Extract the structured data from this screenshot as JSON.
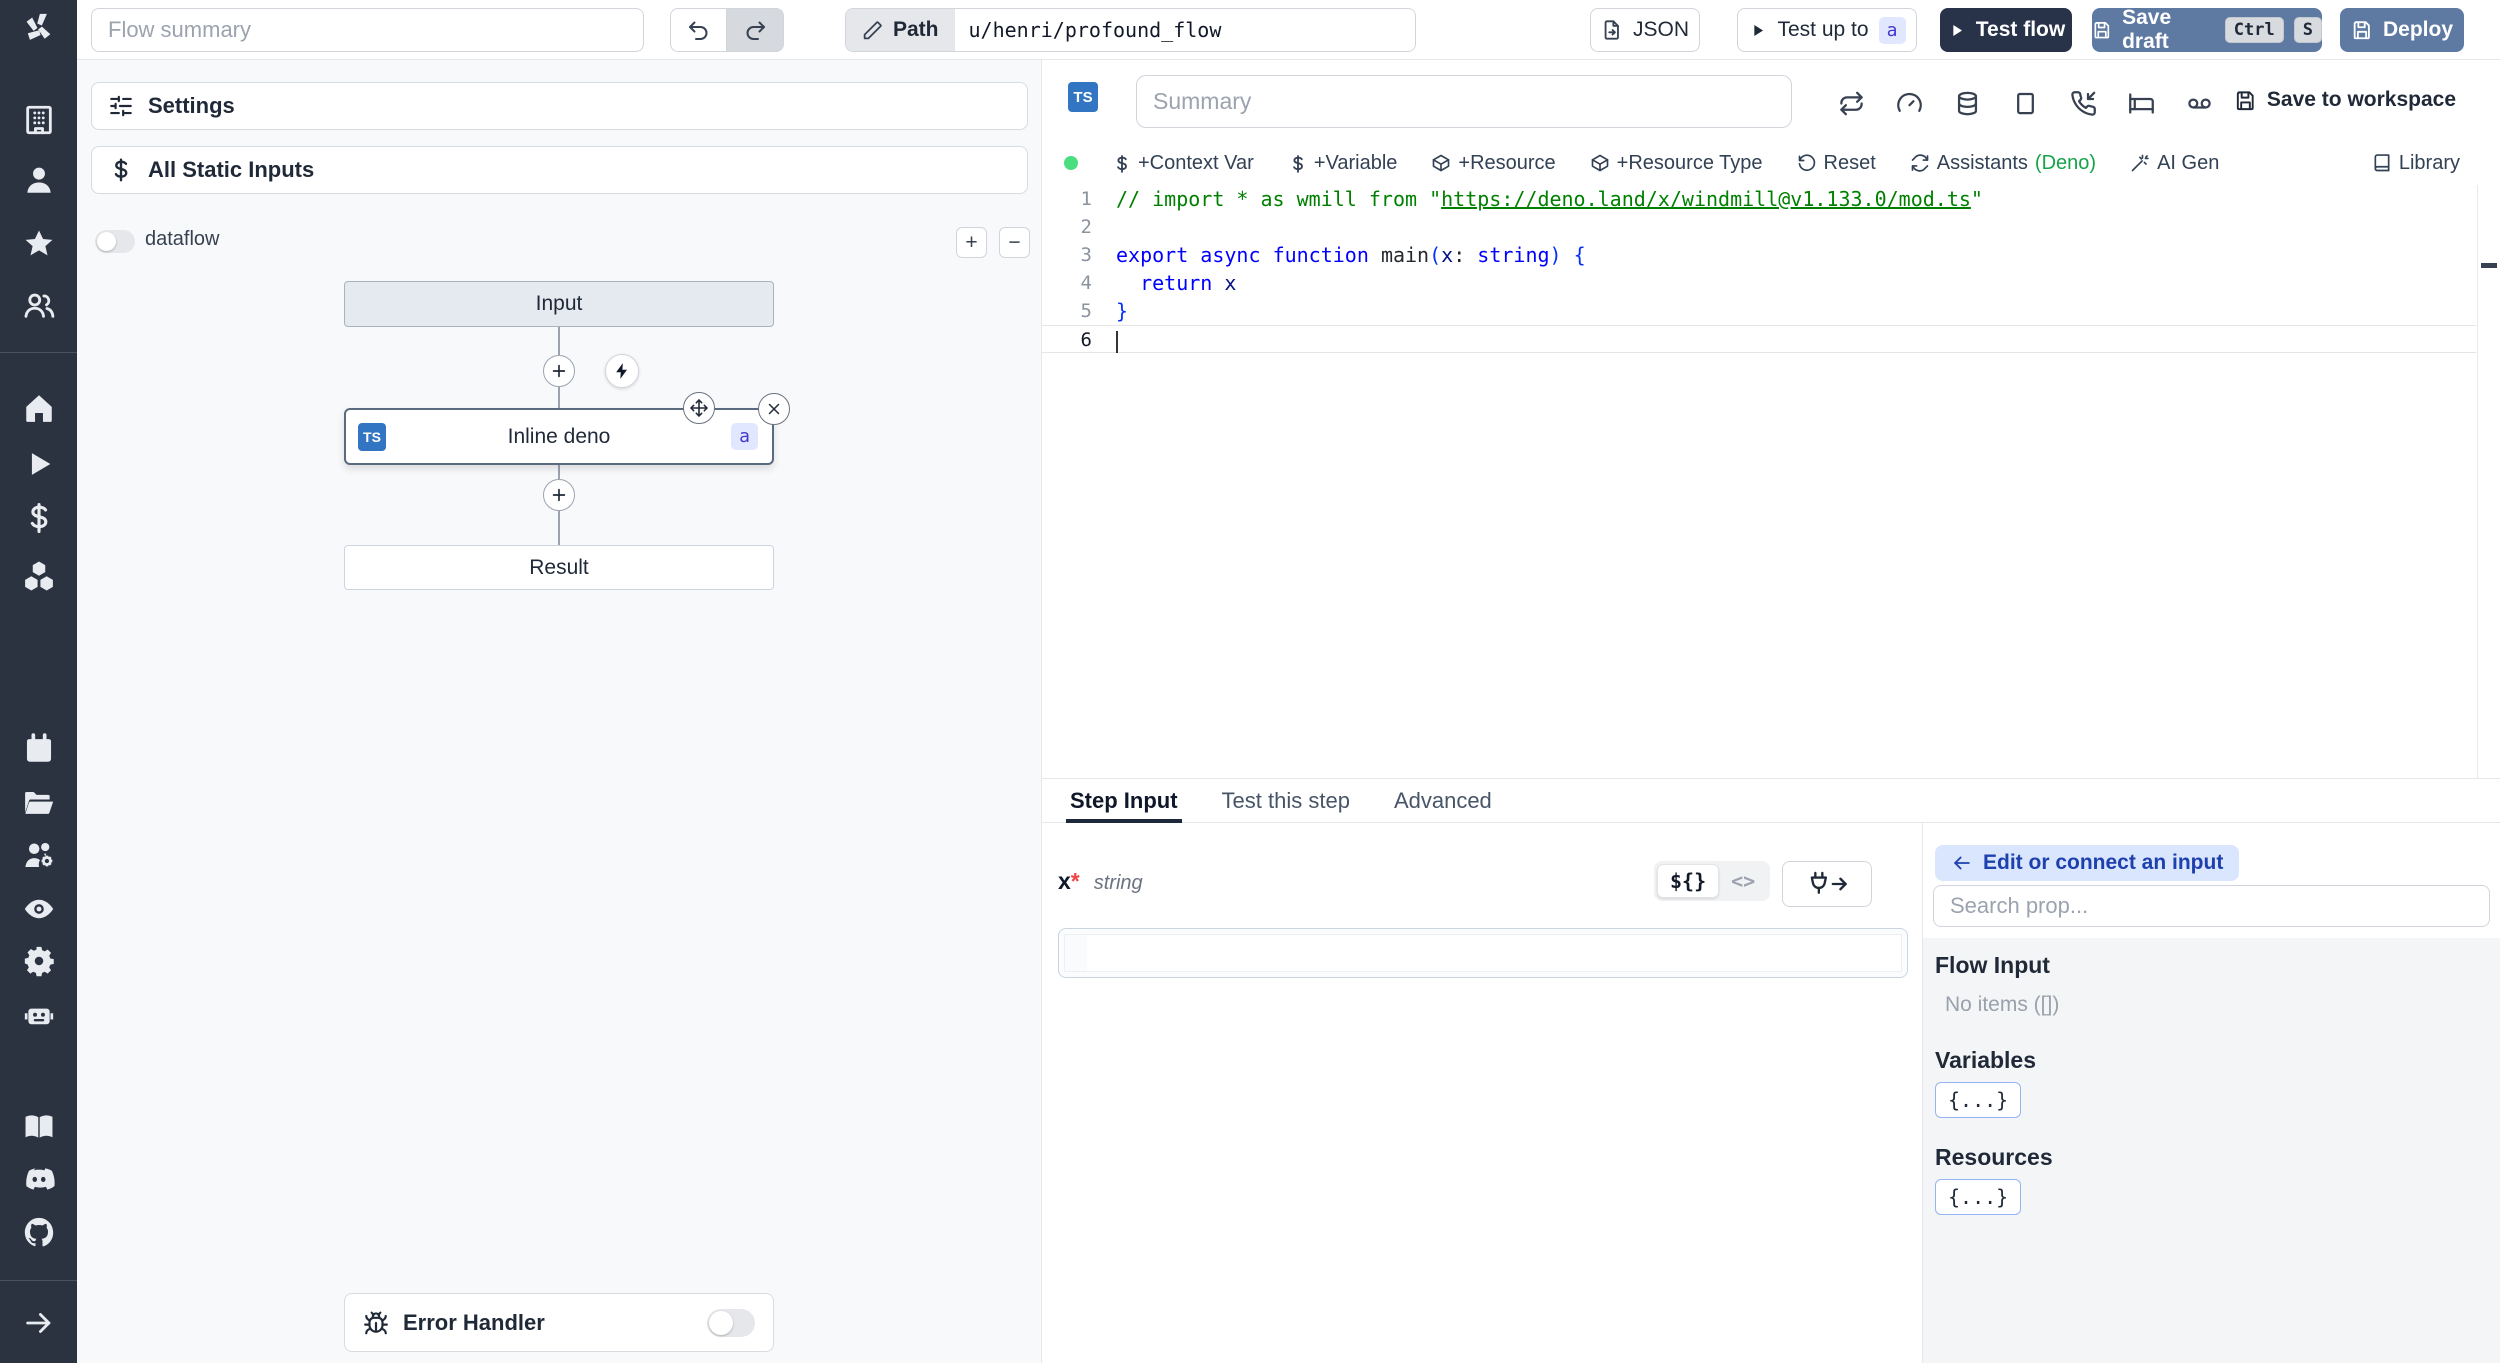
{
  "colors": {
    "sidebar": "#2b3240",
    "steel_blue": "#5e7aa3",
    "dark_navy": "#283349",
    "ts_blue": "#3276c3",
    "badge_bg": "#e0e7ff",
    "badge_text": "#4338ca",
    "deno_green": "#16a34a",
    "status_dot": "#4ade80",
    "comment_green": "#008000"
  },
  "topbar": {
    "flow_summary_placeholder": "Flow summary",
    "path_label": "Path",
    "path_value": "u/henri/profound_flow",
    "json_button": "JSON",
    "test_up_to": "Test up to",
    "test_up_to_badge": "a",
    "test_flow": "Test flow",
    "save_draft": "Save draft",
    "kbd_ctrl": "Ctrl",
    "kbd_s": "S",
    "deploy": "Deploy"
  },
  "sidebar": {
    "icons_top": [
      "windmill-logo",
      "building",
      "user",
      "star",
      "users"
    ],
    "icons_mid": [
      "home",
      "play",
      "dollar",
      "cubes"
    ],
    "icons_tools": [
      "calendar",
      "folder-open",
      "users-gear",
      "eye",
      "gear",
      "robot"
    ],
    "icons_bottom": [
      "book-open",
      "discord",
      "github",
      "arrow-right"
    ]
  },
  "flow_panel": {
    "settings": "Settings",
    "all_static_inputs": "All Static Inputs",
    "dataflow_label": "dataflow",
    "zoom_in": "+",
    "zoom_out": "−",
    "nodes": {
      "input": "Input",
      "step_lang": "TS",
      "step": "Inline deno",
      "step_badge": "a",
      "result": "Result"
    },
    "error_handler": "Error Handler"
  },
  "editor": {
    "lang_badge": "TS",
    "summary_placeholder": "Summary",
    "header_icons": [
      "repeat",
      "gauge",
      "database",
      "square",
      "phone-incoming",
      "bed",
      "voicemail"
    ],
    "save_to_workspace": "Save to workspace",
    "toolbar": {
      "context_var": "+Context Var",
      "variable": "+Variable",
      "resource": "+Resource",
      "resource_type": "+Resource Type",
      "reset": "Reset",
      "assistants": "Assistants",
      "assistants_lang": "(Deno)",
      "ai_gen": "AI Gen",
      "library": "Library"
    }
  },
  "code": {
    "lines": [
      {
        "n": "1",
        "tokens": [
          {
            "c": "com",
            "t": "// import * as wmill from \""
          },
          {
            "c": "comlink",
            "t": "https://deno.land/x/windmill@v1.133.0/mod.ts"
          },
          {
            "c": "com",
            "t": "\""
          }
        ]
      },
      {
        "n": "2",
        "tokens": []
      },
      {
        "n": "3",
        "tokens": [
          {
            "c": "kw",
            "t": "export"
          },
          {
            "c": "pl",
            "t": " "
          },
          {
            "c": "kw",
            "t": "async"
          },
          {
            "c": "pl",
            "t": " "
          },
          {
            "c": "kw",
            "t": "function"
          },
          {
            "c": "pl",
            "t": " "
          },
          {
            "c": "fn",
            "t": "main"
          },
          {
            "c": "br",
            "t": "("
          },
          {
            "c": "vr",
            "t": "x"
          },
          {
            "c": "pl",
            "t": ": "
          },
          {
            "c": "kw",
            "t": "string"
          },
          {
            "c": "br",
            "t": ")"
          },
          {
            "c": "pl",
            "t": " "
          },
          {
            "c": "br",
            "t": "{"
          }
        ]
      },
      {
        "n": "4",
        "tokens": [
          {
            "c": "pl",
            "t": "  "
          },
          {
            "c": "kw",
            "t": "return"
          },
          {
            "c": "pl",
            "t": " "
          },
          {
            "c": "vr",
            "t": "x"
          }
        ]
      },
      {
        "n": "5",
        "tokens": [
          {
            "c": "br",
            "t": "}"
          }
        ]
      },
      {
        "n": "6",
        "tokens": [],
        "cursor": true,
        "active": true
      }
    ]
  },
  "tabs": [
    "Step Input",
    "Test this step",
    "Advanced"
  ],
  "step_input": {
    "arg_name": "x",
    "required_mark": "*",
    "arg_type": "string",
    "toggle_expr": "${}",
    "toggle_code": "<>"
  },
  "prop_panel": {
    "edit_connect": "Edit or connect an input",
    "search_placeholder": "Search prop...",
    "flow_input_title": "Flow Input",
    "flow_input_empty": "No items ([])",
    "variables_title": "Variables",
    "variables_chip": "{...}",
    "resources_title": "Resources",
    "resources_chip": "{...}"
  }
}
